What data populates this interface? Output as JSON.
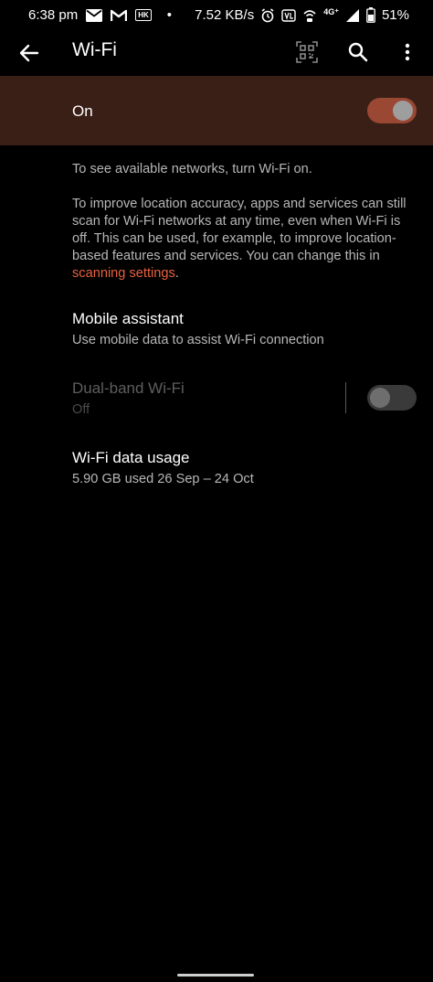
{
  "status_bar": {
    "time": "6:38 pm",
    "hk_badge": "HK",
    "dot": "•",
    "net_speed": "7.52 KB/s",
    "network_type": "4G⁺",
    "battery": "51%"
  },
  "app_bar": {
    "title": "Wi-Fi"
  },
  "master_switch": {
    "label": "On",
    "state": true
  },
  "info": {
    "line1": "To see available networks, turn Wi-Fi on.",
    "line2_before": "To improve location accuracy, apps and services can still scan for Wi-Fi networks at any time, even when Wi-Fi is off. This can be used, for example, to improve location-based features and services. You can change this in ",
    "line2_link": "scanning settings",
    "line2_after": "."
  },
  "preferences": {
    "mobile_assistant": {
      "title": "Mobile assistant",
      "summary": "Use mobile data to assist Wi-Fi connection"
    },
    "dual_band": {
      "title": "Dual-band Wi-Fi",
      "summary": "Off",
      "state": false,
      "enabled": false
    },
    "data_usage": {
      "title": "Wi-Fi data usage",
      "summary": "5.90 GB used 26 Sep – 24 Oct"
    }
  },
  "colors": {
    "background": "#000000",
    "master_bar": "#3a1f17",
    "accent": "#e8613f",
    "toggle_on_track": "#9a4733"
  },
  "icons": [
    "mail-icon",
    "gmail-icon",
    "alarm-icon",
    "volte-icon",
    "wifi-calling-icon",
    "signal-icon",
    "battery-icon",
    "back-arrow-icon",
    "qr-scan-icon",
    "search-icon",
    "more-vert-icon"
  ]
}
